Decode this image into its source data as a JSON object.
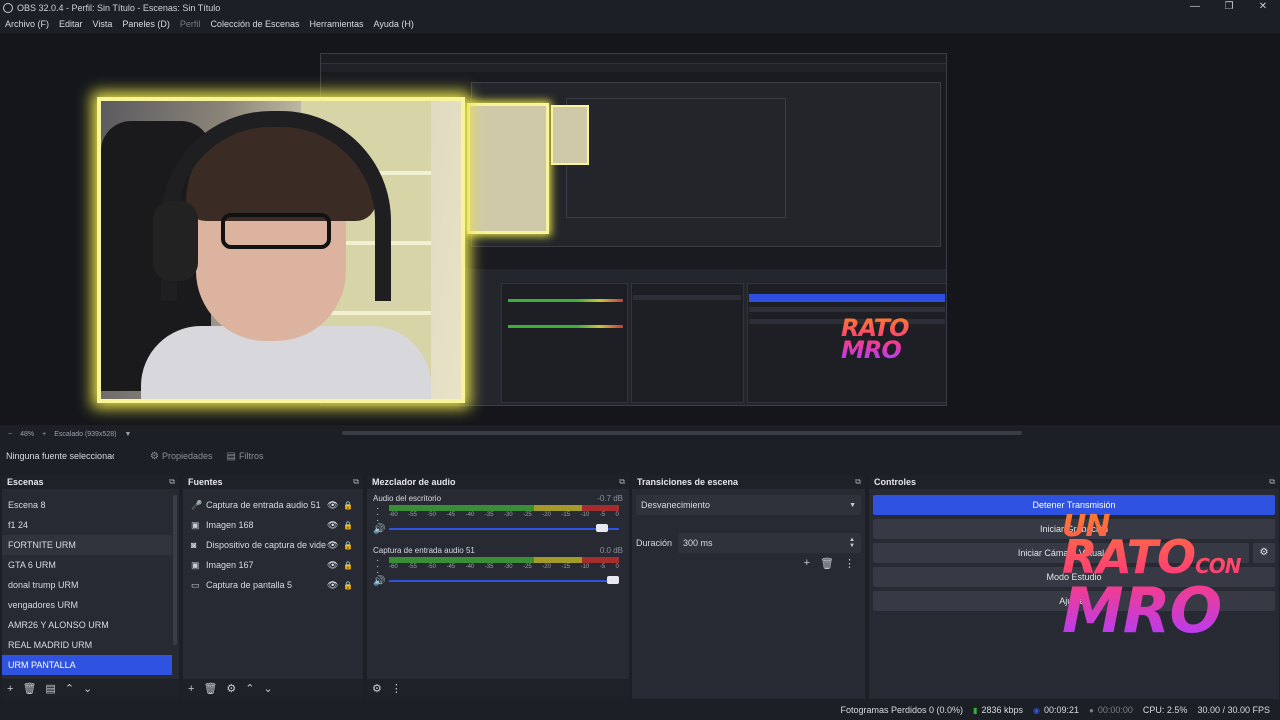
{
  "window": {
    "title": "OBS 32.0.4 - Perfil: Sin Título - Escenas: Sin Título",
    "minimize": "—",
    "maximize": "❐",
    "close": "✕"
  },
  "menu": [
    "Archivo (F)",
    "Editar",
    "Vista",
    "Paneles (D)",
    "Perfil",
    "Colección de Escenas",
    "Herramientas",
    "Ayuda (H)"
  ],
  "preview": {
    "zoom": "48%",
    "scale_label": "Escalado (939x528)"
  },
  "contextbar": {
    "no_source": "Ninguna fuente seleccionada",
    "properties": "Propiedades",
    "filters": "Filtros"
  },
  "scenes": {
    "title": "Escenas",
    "items": [
      "Escena 8",
      "f1 24",
      "FORTNITE URM",
      "GTA 6 URM",
      "donal trump URM",
      "vengadores URM",
      "AMR26 Y ALONSO URM",
      "REAL MADRID URM",
      "URM PANTALLA"
    ],
    "selected": "URM PANTALLA",
    "hover": "FORTNITE URM"
  },
  "sources": {
    "title": "Fuentes",
    "items": [
      {
        "name": "Captura de entrada audio 51",
        "icon": "microphone-icon"
      },
      {
        "name": "Imagen 168",
        "icon": "image-icon"
      },
      {
        "name": "Dispositivo de captura de video",
        "icon": "camera-icon"
      },
      {
        "name": "Imagen 167",
        "icon": "image-icon"
      },
      {
        "name": "Captura de pantalla 5",
        "icon": "monitor-icon"
      }
    ]
  },
  "mixer": {
    "title": "Mezclador de audio",
    "channels": [
      {
        "name": "Audio del escritorio",
        "db": "-0.7 dB",
        "volume": 0.95
      },
      {
        "name": "Captura de entrada audio 51",
        "db": "0.0 dB",
        "volume": 1.0
      }
    ],
    "ticks": [
      "-60",
      "-55",
      "-50",
      "-45",
      "-40",
      "-35",
      "-30",
      "-25",
      "-20",
      "-15",
      "-10",
      "-5",
      "0"
    ]
  },
  "transitions": {
    "title": "Transiciones de escena",
    "selected": "Desvanecimiento",
    "duration_label": "Duración",
    "duration": "300 ms"
  },
  "controls": {
    "title": "Controles",
    "stop_stream": "Detener Transmisión",
    "start_record": "Iniciar Grabación",
    "virtual_cam": "Iniciar Cámara Virtual",
    "studio_mode": "Modo Estudio",
    "settings": "Ajustes"
  },
  "overlay_logo": {
    "line1": "UN",
    "line2": "RATO",
    "line3": "CON",
    "line4": "MRO"
  },
  "statusbar": {
    "dropped": "Fotogramas Perdidos 0 (0.0%)",
    "bitrate": "2836 kbps",
    "stream_time": "00:09:21",
    "record_time": "00:00:00",
    "cpu": "CPU: 2.5%",
    "fps": "30.00 / 30.00 FPS"
  },
  "colors": {
    "accent": "#2f53e0",
    "webcam_border": "#f7f49a",
    "bg": "#1d1f26"
  }
}
